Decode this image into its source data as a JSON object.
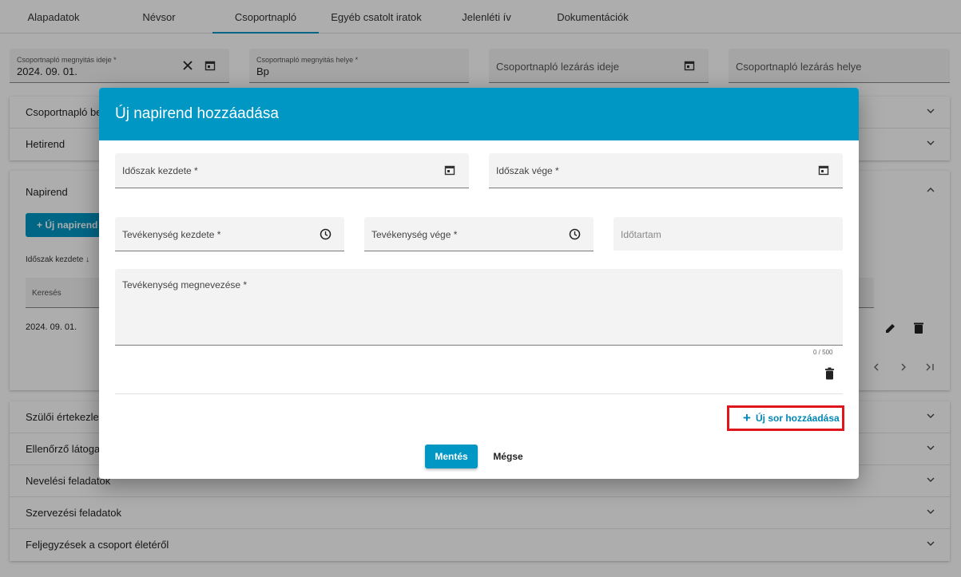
{
  "tabs": [
    "Alapadatok",
    "Névsor",
    "Csoportnapló",
    "Egyéb csatolt iratok",
    "Jelenléti ív",
    "Dokumentációk"
  ],
  "header_fields": {
    "open_date_label": "Csoportnapló megnyitás ideje *",
    "open_date_value": "2024. 09. 01.",
    "open_place_label": "Csoportnapló megnyitás helye *",
    "open_place_value": "Bp",
    "close_date_placeholder": "Csoportnapló lezárás ideje",
    "close_place_placeholder": "Csoportnapló lezárás helye"
  },
  "sections_top": [
    "Csoportnapló be",
    "Hetirend"
  ],
  "napirend": {
    "title": "Napirend",
    "new_button": "Új napirend",
    "column_header": "Időszak kezdete",
    "search_placeholder": "Keresés",
    "row_value": "2024. 09. 01."
  },
  "sections_bottom": [
    "Szülői értekezlet",
    "Ellenőrző látogat",
    "Nevelési feladatok",
    "Szervezési feladatok",
    "Feljegyzések a csoport életéről"
  ],
  "dialog": {
    "title": "Új napirend hozzáadása",
    "period_start_label": "Időszak kezdete *",
    "period_end_label": "Időszak vége *",
    "activity_start_label": "Tevékenység kezdete *",
    "activity_end_label": "Tevékenység vége *",
    "duration_label": "Időtartam",
    "activity_name_label": "Tevékenység megnevezése *",
    "char_counter": "0 / 500",
    "add_row_label": "Új sor hozzáadása",
    "save_label": "Mentés",
    "cancel_label": "Mégse"
  },
  "colors": {
    "primary": "#0097c4",
    "highlight_border": "#e0151e"
  },
  "icons": [
    "calendar-icon",
    "close-icon",
    "clock-icon",
    "chevron-down-icon",
    "chevron-up-icon",
    "arrow-down-icon",
    "plus-icon",
    "edit-icon",
    "delete-icon",
    "chevron-left-icon",
    "chevron-right-icon",
    "last-page-icon"
  ]
}
